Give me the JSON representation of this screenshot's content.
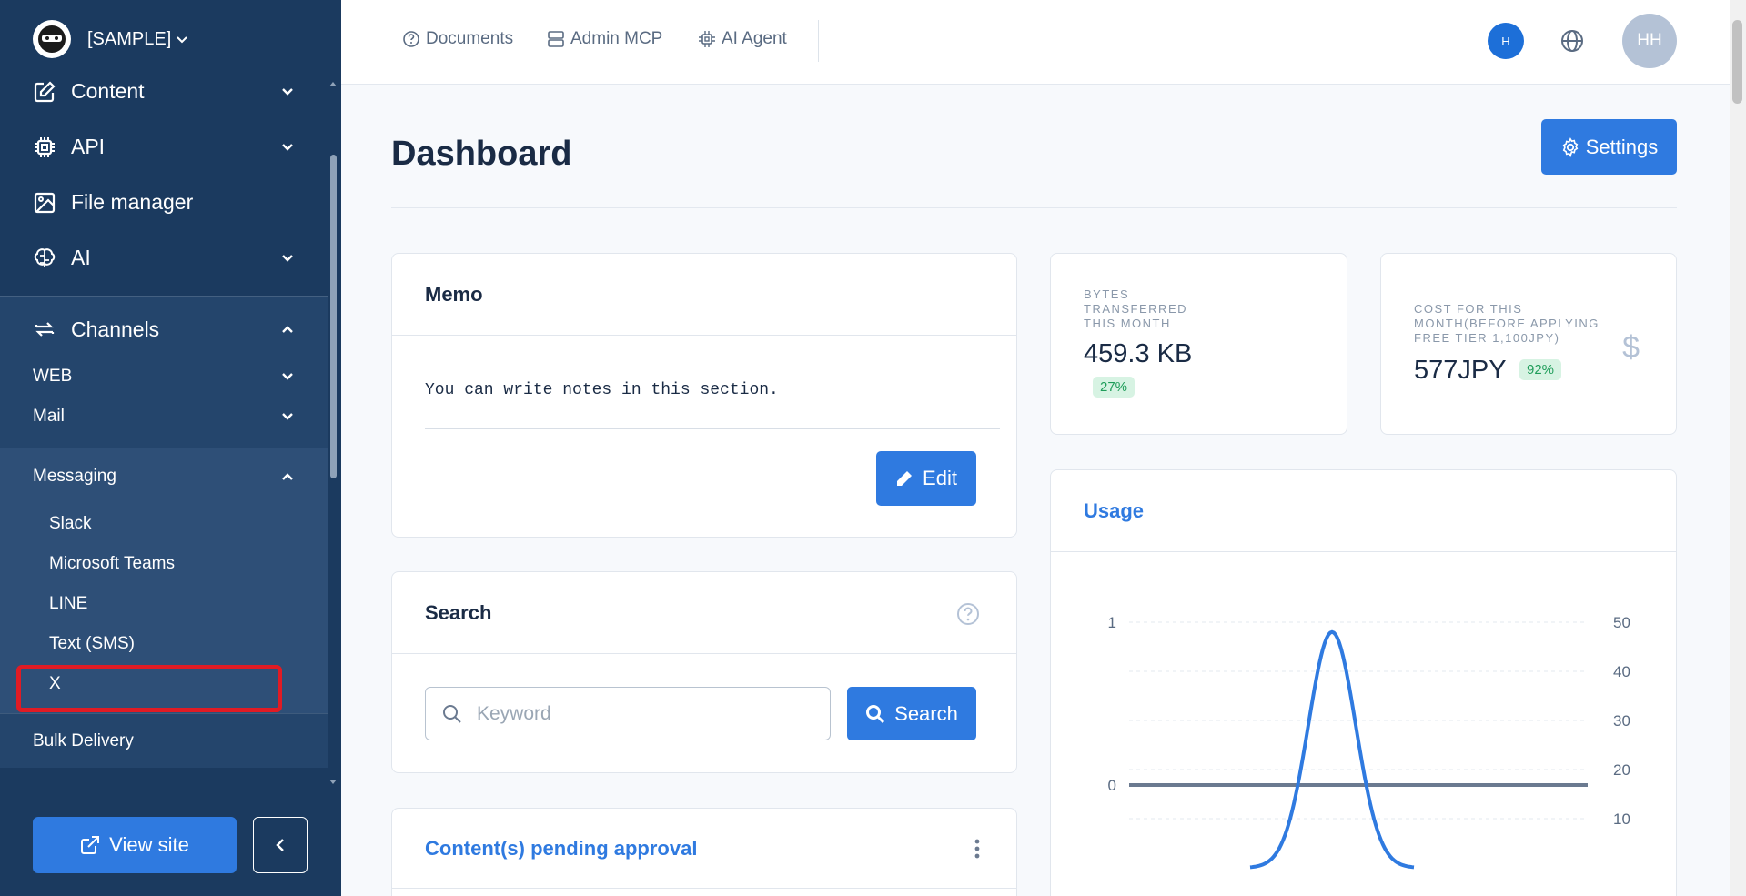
{
  "sidebar": {
    "brand": {
      "name": "[SAMPLE]"
    },
    "nav": [
      {
        "label": "Content",
        "icon": "edit-icon",
        "expandable": true
      },
      {
        "label": "API",
        "icon": "chip-icon",
        "expandable": true
      },
      {
        "label": "File manager",
        "icon": "image-icon",
        "expandable": false
      },
      {
        "label": "AI",
        "icon": "brain-icon",
        "expandable": true
      }
    ],
    "channels": {
      "label": "Channels",
      "web": "WEB",
      "mail": "Mail",
      "messaging": {
        "label": "Messaging",
        "items": [
          "Slack",
          "Microsoft Teams",
          "LINE",
          "Text (SMS)",
          "X"
        ]
      },
      "bulk": "Bulk Delivery"
    },
    "view_site": "View site"
  },
  "topbar": {
    "links": [
      {
        "label": "Documents",
        "icon": "question-circle-icon"
      },
      {
        "label": "Admin MCP",
        "icon": "server-icon"
      },
      {
        "label": "AI Agent",
        "icon": "chip-icon"
      }
    ],
    "badge": "H",
    "avatar": "HH"
  },
  "main": {
    "title": "Dashboard",
    "settings_label": "Settings",
    "memo": {
      "title": "Memo",
      "text": "You can write notes in this section.",
      "edit_label": "Edit"
    },
    "search": {
      "title": "Search",
      "placeholder": "Keyword",
      "button": "Search"
    },
    "pending": {
      "title": "Content(s) pending approval"
    },
    "stats": {
      "bytes": {
        "label_lines": [
          "BYTES",
          "TRANSFERRED",
          "THIS MONTH"
        ],
        "value": "459.3 KB",
        "badge": "27%"
      },
      "cost": {
        "label_lines": [
          "COST FOR THIS",
          "MONTH(BEFORE APPLYING",
          "FREE TIER 1,100JPY)"
        ],
        "value": "577JPY",
        "badge": "92%"
      }
    },
    "usage": {
      "title": "Usage"
    }
  },
  "colors": {
    "accent": "#2f7ae0",
    "sidebar": "#1b3a5f",
    "highlight": "#e01b24"
  },
  "chart_data": {
    "type": "line",
    "left_axis": {
      "ticks": [
        0,
        1
      ]
    },
    "right_axis": {
      "ticks": [
        10,
        20,
        30,
        40,
        50
      ]
    },
    "series": [
      {
        "axis": "left",
        "color": "#6b7a90",
        "values": "flat at 0"
      },
      {
        "axis": "right",
        "color": "#2f7ae0",
        "peak": 48,
        "shape": "bell"
      }
    ]
  }
}
